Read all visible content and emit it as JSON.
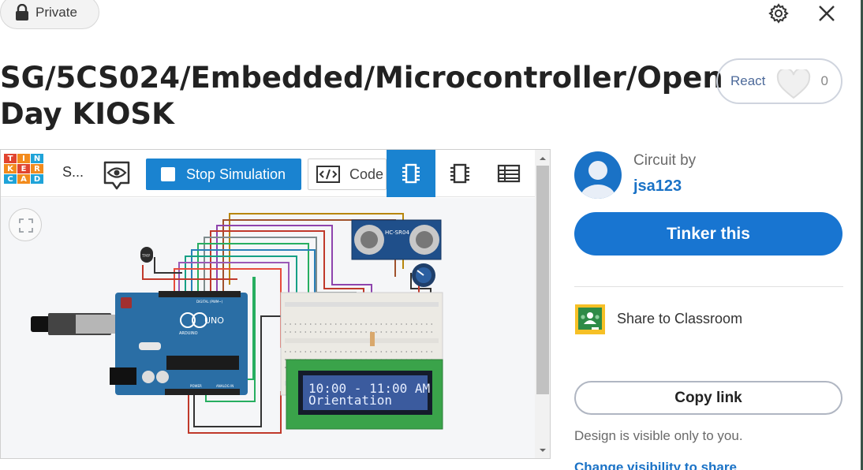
{
  "header": {
    "visibility_label": "Private",
    "settings_icon": "gear-icon",
    "close_icon": "close-icon"
  },
  "design": {
    "title": "SG/5CS024/Embedded/Microcontroller/Open Day KIOSK"
  },
  "react": {
    "label": "React",
    "count": "0",
    "icon": "heart-icon"
  },
  "simulator": {
    "logo_letters": [
      "T",
      "I",
      "N",
      "K",
      "E",
      "R",
      "C",
      "A",
      "D"
    ],
    "logo_colors": [
      "#e1442f",
      "#f28b1d",
      "#1fa3d8",
      "#f28b1d",
      "#e1442f",
      "#f28b1d",
      "#1fa3d8",
      "#f28b1d",
      "#1fa3d8"
    ],
    "project_name": "S...",
    "stop_label": "Stop Simulation",
    "code_label": "Code",
    "accent": "#1a83d0"
  },
  "board": {
    "arduino_brand": "UNO",
    "arduino_sub": "ARDUINO",
    "digital_label": "DIGITAL (PWM~)",
    "power_label": "POWER",
    "analog_label": "ANALOG IN",
    "sensor_label": "HC-SR04",
    "temp_label": "TMP"
  },
  "lcd": {
    "line1": "10:00 - 11:00 AM",
    "line2": "Orientation"
  },
  "author": {
    "caption": "Circuit by",
    "name": "jsa123"
  },
  "actions": {
    "tinker_label": "Tinker this",
    "classroom_label": "Share to Classroom",
    "copy_label": "Copy link",
    "visible_note": "Design is visible only to you.",
    "change_visibility": "Change visibility to share"
  }
}
